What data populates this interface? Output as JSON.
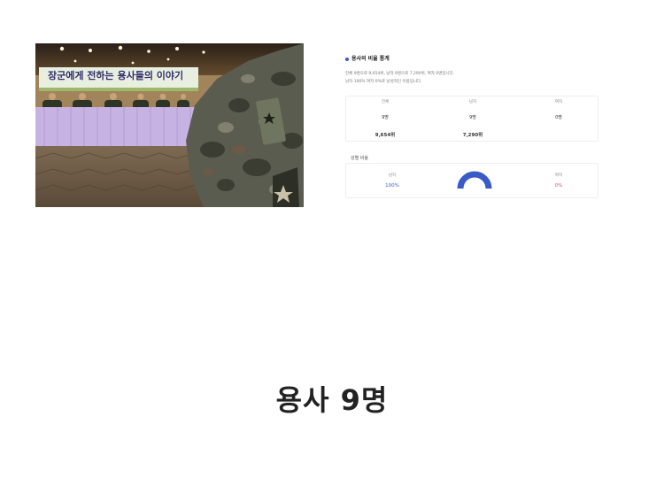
{
  "photo": {
    "banner_text": "장군에게 전하는 용사들의 이야기"
  },
  "stats": {
    "title": "용사의 비율 통계",
    "summary_line1": "전체 9명으로 9,654위, 남자 9명으로 7,290위, 여자 0명입니다.",
    "summary_line2": "남자 100% 여자 0%로 남성적인 이름입니다.",
    "table": {
      "columns": [
        {
          "header": "전체",
          "count": "9명",
          "rank": "9,654위"
        },
        {
          "header": "남자",
          "count": "9명",
          "rank": "7,290위"
        },
        {
          "header": "여자",
          "count": "0명",
          "rank": ""
        }
      ]
    },
    "gender_section_label": "성별 비율",
    "gender": {
      "male_label": "남자",
      "male_pct": "100%",
      "female_label": "여자",
      "female_pct": "0%",
      "male_fraction": 1.0
    },
    "colors": {
      "accent": "#3a5bc7",
      "female": "#e05555"
    }
  },
  "caption": "용사 9명"
}
